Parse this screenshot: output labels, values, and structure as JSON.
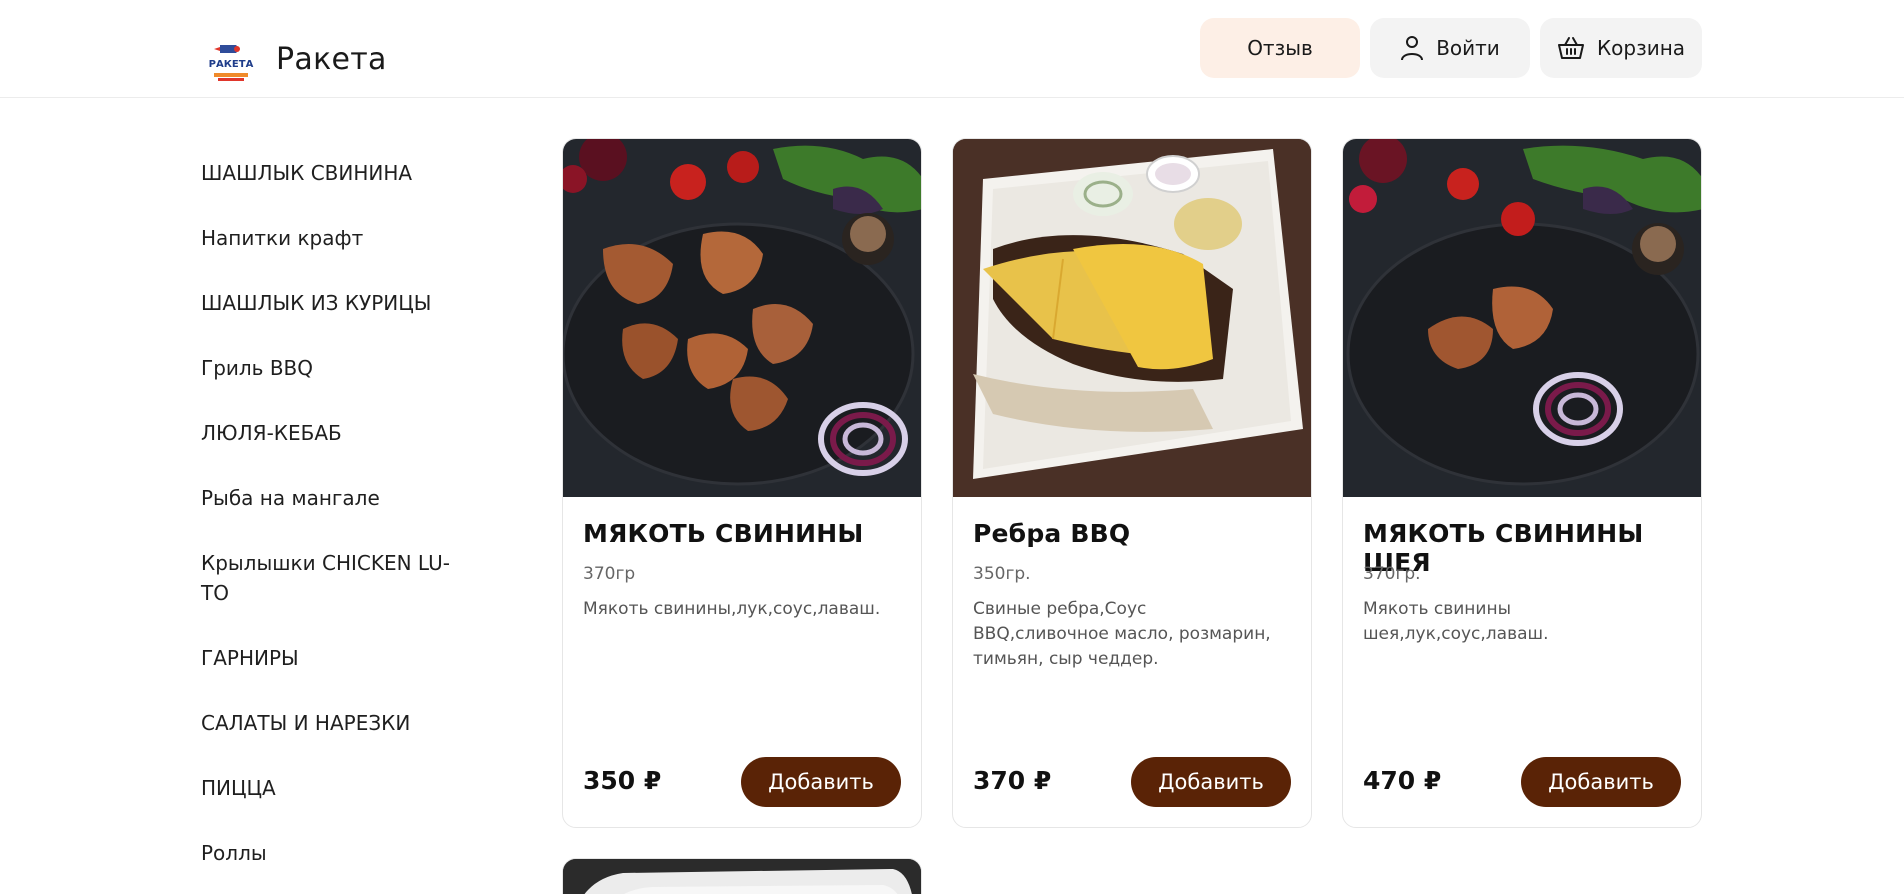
{
  "header": {
    "brand": "Ракета",
    "logo_text": "РАКЕТА",
    "review_label": "Отзыв",
    "login_label": "Войти",
    "cart_label": "Корзина"
  },
  "sidebar": {
    "items": [
      {
        "label": "ШАШЛЫК СВИНИНА"
      },
      {
        "label": "Напитки крафт"
      },
      {
        "label": "ШАШЛЫК ИЗ КУРИЦЫ"
      },
      {
        "label": "Гриль BBQ"
      },
      {
        "label": "ЛЮЛЯ-КЕБАБ"
      },
      {
        "label": "Рыба на мангале"
      },
      {
        "label": "Крылышки CHICKEN LU-TO"
      },
      {
        "label": "ГАРНИРЫ"
      },
      {
        "label": "САЛАТЫ И НАРЕЗКИ"
      },
      {
        "label": "ПИЦЦА"
      },
      {
        "label": "Роллы"
      }
    ]
  },
  "products": [
    {
      "title": "МЯКОТЬ СВИНИНЫ",
      "weight": "370гр",
      "description": "Мякоть свинины,лук,соус,лаваш.",
      "price": "350 ₽",
      "add_label": "Добавить"
    },
    {
      "title": "Ребра BBQ",
      "weight": "350гр.",
      "description": "Свиные ребра,Соус BBQ,сливочное масло, розмарин, тимьян, сыр чеддер.",
      "price": "370 ₽",
      "add_label": "Добавить"
    },
    {
      "title": "МЯКОТЬ СВИНИНЫ ШЕЯ",
      "weight": "370гр.",
      "description": "Мякоть свинины шея,лук,соус,лаваш.",
      "price": "470 ₽",
      "add_label": "Добавить"
    }
  ],
  "colors": {
    "accent": "#5a2306",
    "review_bg": "#fdefe6",
    "button_bg": "#f3f3f3"
  },
  "icons": {
    "login": "user-icon",
    "cart": "basket-icon"
  }
}
